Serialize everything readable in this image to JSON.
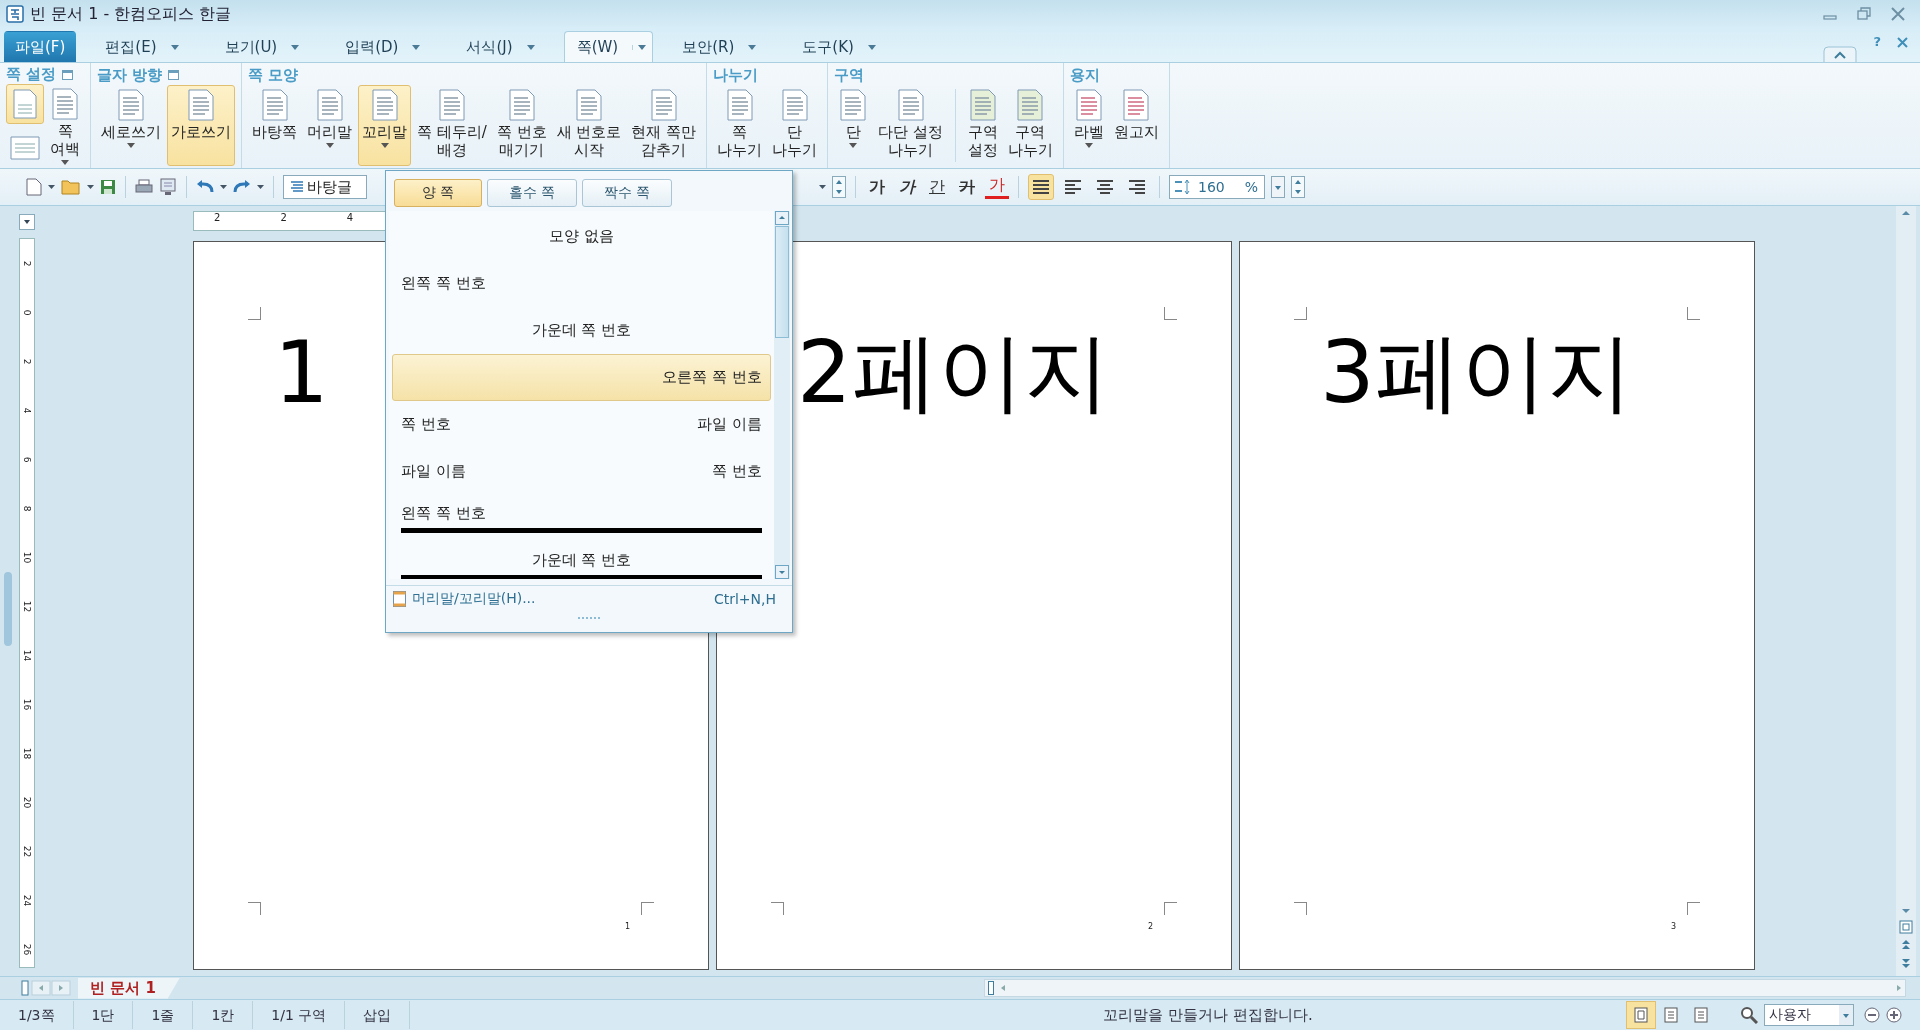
{
  "window": {
    "title": "빈 문서 1 - 한컴오피스 한글",
    "help": "?"
  },
  "menu_tabs": [
    {
      "label": "파일(F)",
      "kind": "file",
      "selected": false,
      "menu": false
    },
    {
      "label": "편집(E)",
      "kind": "tab",
      "selected": false,
      "menu": true
    },
    {
      "label": "보기(U)",
      "kind": "tab",
      "selected": false,
      "menu": true
    },
    {
      "label": "입력(D)",
      "kind": "tab",
      "selected": false,
      "menu": true
    },
    {
      "label": "서식(J)",
      "kind": "tab",
      "selected": false,
      "menu": true
    },
    {
      "label": "쪽(W)",
      "kind": "tab",
      "selected": true,
      "menu": true
    },
    {
      "label": "보안(R)",
      "kind": "tab",
      "selected": false,
      "menu": true
    },
    {
      "label": "도구(K)",
      "kind": "tab",
      "selected": false,
      "menu": true
    }
  ],
  "ribbon": {
    "groups": [
      {
        "title": "쪽 설정",
        "launcher": true,
        "items": [
          {
            "kind": "stack",
            "selected": true
          },
          {
            "kind": "button",
            "label": "쪽\n여백",
            "menu": true,
            "selected": false
          }
        ]
      },
      {
        "title": "글자 방향",
        "launcher": true,
        "items": [
          {
            "kind": "button",
            "label": "세로쓰기",
            "menu": true,
            "selected": false
          },
          {
            "kind": "button",
            "label": "가로쓰기",
            "menu": false,
            "selected": true
          }
        ]
      },
      {
        "title": "쪽 모양",
        "launcher": false,
        "items": [
          {
            "kind": "button",
            "label": "바탕쪽",
            "menu": false,
            "selected": false
          },
          {
            "kind": "button",
            "label": "머리말",
            "menu": true,
            "selected": false
          },
          {
            "kind": "button",
            "label": "꼬리말",
            "menu": true,
            "selected": true
          },
          {
            "kind": "button",
            "label": "쪽 테두리/\n배경",
            "menu": false,
            "selected": false
          },
          {
            "kind": "button",
            "label": "쪽 번호\n매기기",
            "menu": false,
            "selected": false
          },
          {
            "kind": "button",
            "label": "새 번호로\n시작",
            "menu": false,
            "selected": false
          },
          {
            "kind": "button",
            "label": "현재 쪽만\n감추기",
            "menu": false,
            "selected": false
          }
        ]
      },
      {
        "title": "나누기",
        "launcher": false,
        "items": [
          {
            "kind": "button",
            "label": "쪽\n나누기",
            "menu": false,
            "selected": false
          },
          {
            "kind": "button",
            "label": "단\n나누기",
            "menu": false,
            "selected": false
          }
        ]
      },
      {
        "title": "구역",
        "launcher": false,
        "items": [
          {
            "kind": "button",
            "label": "단",
            "menu": true,
            "selected": false
          },
          {
            "kind": "button",
            "label": "다단 설정\n나누기",
            "menu": false,
            "selected": false
          },
          {
            "kind": "separator"
          },
          {
            "kind": "button",
            "label": "구역\n설정",
            "menu": false,
            "selected": false
          },
          {
            "kind": "button",
            "label": "구역\n나누기",
            "menu": false,
            "selected": false
          }
        ]
      },
      {
        "title": "용지",
        "launcher": false,
        "items": [
          {
            "kind": "button",
            "label": "라벨",
            "menu": true,
            "selected": false
          },
          {
            "kind": "button",
            "label": "원고지",
            "menu": false,
            "selected": false
          }
        ]
      }
    ]
  },
  "toolbar": {
    "style_field": {
      "value": "바탕글"
    },
    "format_buttons": [
      {
        "label": "가",
        "kind": "bold"
      },
      {
        "label": "가",
        "kind": "italic"
      },
      {
        "label": "간",
        "kind": "underline"
      },
      {
        "label": "가",
        "kind": "strike"
      },
      {
        "label": "가",
        "kind": "color"
      }
    ],
    "align_buttons": [
      {
        "selected": true
      },
      {
        "selected": false
      },
      {
        "selected": false
      },
      {
        "selected": false
      }
    ],
    "line_spacing": {
      "value": "160",
      "unit": "%"
    }
  },
  "ruler": {
    "labels": [
      "2",
      "2",
      "4"
    ]
  },
  "vertical_ruler": {
    "labels": [
      "2",
      "0",
      "2",
      "4",
      "6",
      "8",
      "10",
      "12",
      "14",
      "16",
      "18",
      "20",
      "22",
      "24",
      "26"
    ]
  },
  "pages": [
    {
      "heading": "1",
      "number": "1"
    },
    {
      "heading": "2페이지",
      "number": "2"
    },
    {
      "heading": "3페이지",
      "number": "3"
    }
  ],
  "footer_menu": {
    "tabs": [
      {
        "label": "양 쪽",
        "selected": true
      },
      {
        "label": "홀수 쪽",
        "selected": false
      },
      {
        "label": "짝수 쪽",
        "selected": false
      }
    ],
    "options": [
      {
        "kind": "center",
        "texts": [
          "모양 없음"
        ],
        "selected": false
      },
      {
        "kind": "left",
        "texts": [
          "왼쪽 쪽 번호"
        ],
        "selected": false
      },
      {
        "kind": "center",
        "texts": [
          "가운데 쪽 번호"
        ],
        "selected": false
      },
      {
        "kind": "right",
        "texts": [
          "오른쪽 쪽 번호"
        ],
        "selected": true
      },
      {
        "kind": "split",
        "texts": [
          "쪽 번호",
          "파일 이름"
        ],
        "selected": false
      },
      {
        "kind": "split",
        "texts": [
          "파일 이름",
          "쪽 번호"
        ],
        "selected": false
      },
      {
        "kind": "leftrule",
        "texts": [
          "왼쪽 쪽 번호"
        ],
        "selected": false
      },
      {
        "kind": "centerrule",
        "texts": [
          "가운데 쪽 번호"
        ],
        "selected": false
      }
    ],
    "command": {
      "label": "머리말/꼬리말(H)...",
      "shortcut": "Ctrl+N,H"
    }
  },
  "document_tabs": [
    {
      "label": "빈 문서 1",
      "selected": true
    }
  ],
  "status_bar": {
    "items": [
      "1/3쪽",
      "1단",
      "1줄",
      "1칸",
      "1/1 구역",
      "삽입"
    ],
    "message": "꼬리말을 만들거나 편집합니다.",
    "view_buttons": [
      {
        "selected": true
      },
      {
        "selected": false
      },
      {
        "selected": false
      }
    ],
    "zoom": {
      "value": "사용자"
    }
  }
}
